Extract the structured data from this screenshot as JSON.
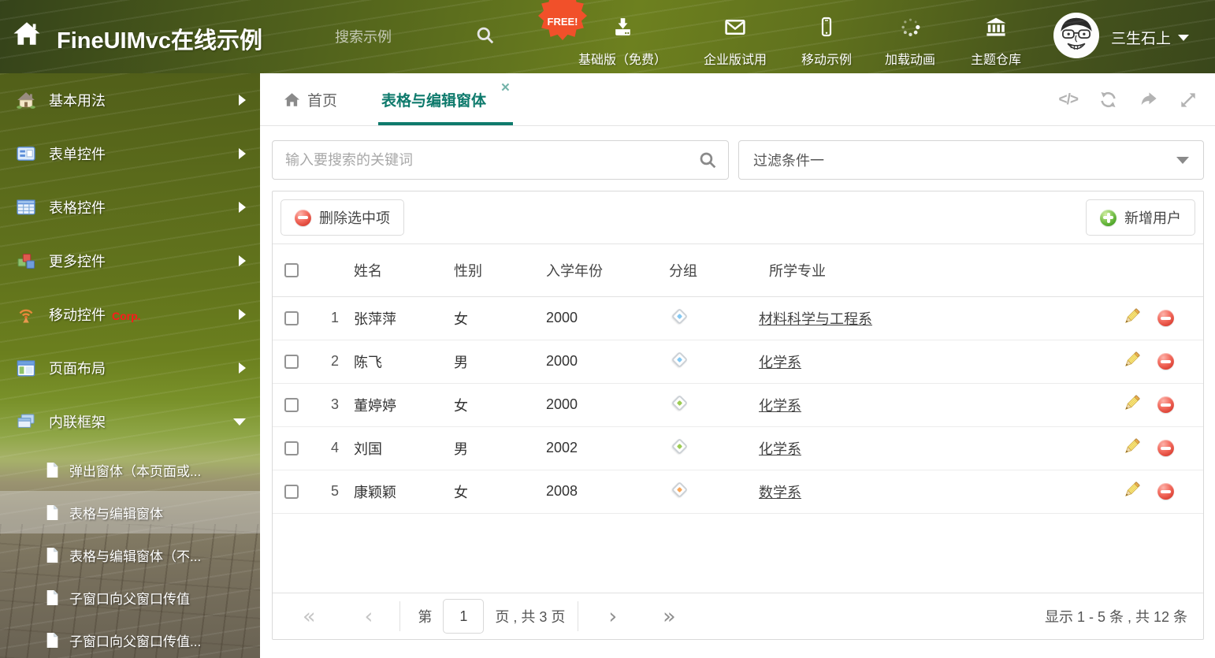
{
  "header": {
    "logo": "FineUIMvc在线示例",
    "search_placeholder": "搜索示例",
    "free_badge": "FREE!",
    "nav": [
      {
        "label": "基础版（免费）"
      },
      {
        "label": "企业版试用"
      },
      {
        "label": "移动示例"
      },
      {
        "label": "加载动画"
      },
      {
        "label": "主题仓库"
      }
    ],
    "user": "三生石上"
  },
  "sidebar": {
    "items": [
      {
        "label": "基本用法"
      },
      {
        "label": "表单控件"
      },
      {
        "label": "表格控件"
      },
      {
        "label": "更多控件"
      },
      {
        "label": "移动控件",
        "badge": "Corp."
      },
      {
        "label": "页面布局"
      },
      {
        "label": "内联框架"
      }
    ],
    "subitems": [
      {
        "label": "弹出窗体（本页面或..."
      },
      {
        "label": "表格与编辑窗体"
      },
      {
        "label": "表格与编辑窗体（不..."
      },
      {
        "label": "子窗口向父窗口传值"
      },
      {
        "label": "子窗口向父窗口传值..."
      }
    ]
  },
  "tabs": {
    "home": "首页",
    "active": "表格与编辑窗体"
  },
  "filters": {
    "search_placeholder": "输入要搜索的关键词",
    "filter_value": "过滤条件一"
  },
  "toolbar": {
    "delete_label": "删除选中项",
    "add_label": "新增用户"
  },
  "table": {
    "headers": {
      "name": "姓名",
      "gender": "性别",
      "year": "入学年份",
      "group": "分组",
      "major": "所学专业"
    },
    "rows": [
      {
        "num": "1",
        "name": "张萍萍",
        "gender": "女",
        "year": "2000",
        "tag": "blue",
        "major": "材料科学与工程系"
      },
      {
        "num": "2",
        "name": "陈飞",
        "gender": "男",
        "year": "2000",
        "tag": "blue",
        "major": "化学系"
      },
      {
        "num": "3",
        "name": "董婷婷",
        "gender": "女",
        "year": "2000",
        "tag": "green",
        "major": "化学系"
      },
      {
        "num": "4",
        "name": "刘国",
        "gender": "男",
        "year": "2002",
        "tag": "green",
        "major": "化学系"
      },
      {
        "num": "5",
        "name": "康颖颖",
        "gender": "女",
        "year": "2008",
        "tag": "orange",
        "major": "数学系"
      }
    ]
  },
  "pagination": {
    "first": "«",
    "prev": "‹",
    "next": "›",
    "last": "»",
    "page_prefix": "第",
    "page_value": "1",
    "page_suffix": "页 , 共 3 页",
    "summary": "显示 1 - 5 条 , 共 12 条"
  },
  "icons": {
    "code_glyph": "</>",
    "close_glyph": "×"
  },
  "colors": {
    "accent_teal": "#0e7a6c",
    "delete_red": "#dd4437",
    "add_green": "#4ea52a",
    "tag_blue": "#85c8f2",
    "tag_green": "#9ccc53",
    "tag_orange": "#f6a75c"
  }
}
